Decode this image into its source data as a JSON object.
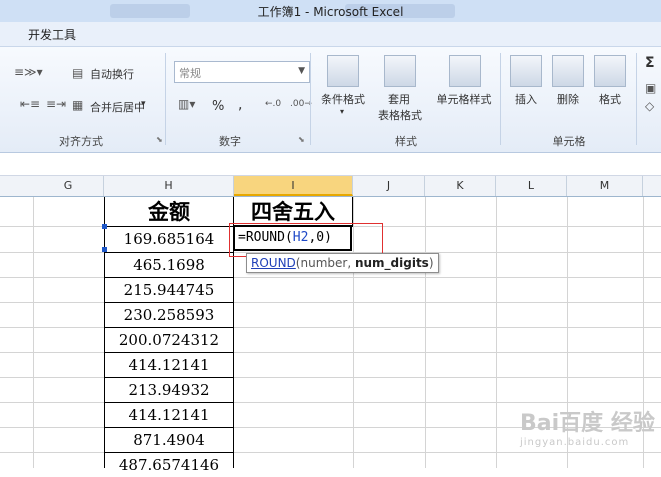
{
  "window": {
    "title": "工作簿1 - Microsoft Excel"
  },
  "menu": {
    "developer_tab": "开发工具"
  },
  "ribbon": {
    "alignment": {
      "wrap_text": "自动换行",
      "merge_center": "合并后居中",
      "group_label": "对齐方式"
    },
    "number": {
      "format_value": "常规",
      "percent": "%",
      "comma": ",",
      "group_label": "数字"
    },
    "styles": {
      "conditional": "条件格式",
      "table_line1": "套用",
      "table_line2": "表格格式",
      "cell_styles": "单元格样式",
      "group_label": "样式"
    },
    "cells": {
      "insert": "插入",
      "delete": "删除",
      "format": "格式",
      "group_label": "单元格"
    },
    "editing": {
      "sigma": "Σ"
    }
  },
  "columns": [
    "G",
    "H",
    "I",
    "J",
    "K",
    "L",
    "M"
  ],
  "active_column": "I",
  "sheet": {
    "h_header": "金额",
    "i_header": "四舍五入",
    "h_values": [
      "169.685164",
      "465.1698",
      "215.944745",
      "230.258593",
      "200.0724312",
      "414.12141",
      "213.94932",
      "414.12141",
      "871.4904",
      "487.6574146"
    ],
    "formula": {
      "prefix": "=ROUND(",
      "ref": "H2",
      "suffix": ",0)"
    }
  },
  "tooltip": {
    "fname": "ROUND",
    "args_plain": "(number, ",
    "args_bold": "num_digits",
    "close": ")"
  },
  "watermark": {
    "brand": "Bai百度 经验",
    "sub": "jingyan.baidu.com"
  }
}
